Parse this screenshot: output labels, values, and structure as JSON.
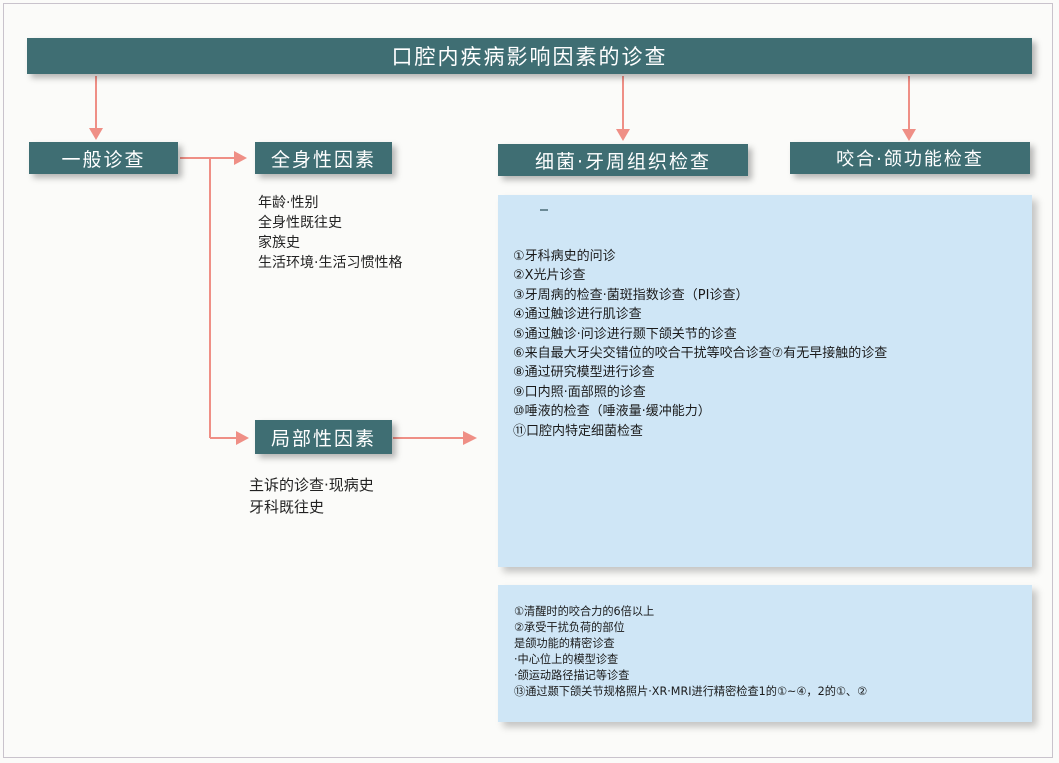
{
  "diagram": {
    "title": "口腔内疾病影响因素的诊查",
    "general_exam": "一般诊查",
    "systemic_factors": {
      "label": "全身性因素",
      "items": [
        "年龄·性别",
        "全身性既往史",
        "家族史",
        "生活环境·生活习惯性格"
      ]
    },
    "local_factors": {
      "label": "局部性因素",
      "items": [
        "主诉的诊查·现病史",
        "牙科既往史"
      ]
    },
    "bacteria_exam": {
      "label": "细菌·牙周组织检查",
      "items": [
        "①牙科病史的问诊",
        "②X光片诊查",
        "③牙周病的检查·菌斑指数诊查（PI诊查）",
        "④通过触诊进行肌诊查",
        "⑤通过触诊·问诊进行颞下颌关节的诊查",
        "⑥来自最大牙尖交错位的咬合干扰等咬合诊查⑦有无早接触的诊查",
        "⑧通过研究模型进行诊查",
        "⑨口内照·面部照的诊查",
        "⑩唾液的检查（唾液量·缓冲能力）",
        "⑪口腔内特定细菌检查"
      ]
    },
    "occlusal_exam": {
      "label": "咬合·颌功能检查",
      "items": [
        "①清醒时的咬合力的6倍以上",
        "②承受干扰负荷的部位",
        "是颌功能的精密诊查",
        "·中心位上的模型诊查",
        "·颌运动路径描记等诊查",
        "⑬通过颞下颌关节规格照片·XR·MRI进行精密检查1的①~④，2的①、②"
      ]
    }
  },
  "colors": {
    "box_fill": "#3f6e73",
    "arrow": "#ef8f86",
    "panel_fill": "#cfe6f6"
  }
}
